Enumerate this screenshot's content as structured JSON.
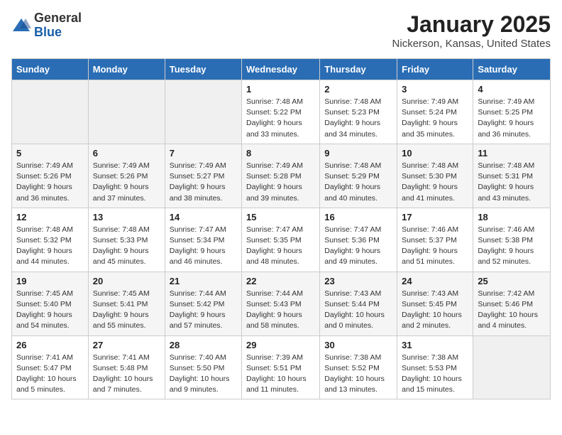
{
  "header": {
    "logo_general": "General",
    "logo_blue": "Blue",
    "title": "January 2025",
    "subtitle": "Nickerson, Kansas, United States"
  },
  "weekdays": [
    "Sunday",
    "Monday",
    "Tuesday",
    "Wednesday",
    "Thursday",
    "Friday",
    "Saturday"
  ],
  "weeks": [
    [
      {
        "day": "",
        "info": ""
      },
      {
        "day": "",
        "info": ""
      },
      {
        "day": "",
        "info": ""
      },
      {
        "day": "1",
        "info": "Sunrise: 7:48 AM\nSunset: 5:22 PM\nDaylight: 9 hours and 33 minutes."
      },
      {
        "day": "2",
        "info": "Sunrise: 7:48 AM\nSunset: 5:23 PM\nDaylight: 9 hours and 34 minutes."
      },
      {
        "day": "3",
        "info": "Sunrise: 7:49 AM\nSunset: 5:24 PM\nDaylight: 9 hours and 35 minutes."
      },
      {
        "day": "4",
        "info": "Sunrise: 7:49 AM\nSunset: 5:25 PM\nDaylight: 9 hours and 36 minutes."
      }
    ],
    [
      {
        "day": "5",
        "info": "Sunrise: 7:49 AM\nSunset: 5:26 PM\nDaylight: 9 hours and 36 minutes."
      },
      {
        "day": "6",
        "info": "Sunrise: 7:49 AM\nSunset: 5:26 PM\nDaylight: 9 hours and 37 minutes."
      },
      {
        "day": "7",
        "info": "Sunrise: 7:49 AM\nSunset: 5:27 PM\nDaylight: 9 hours and 38 minutes."
      },
      {
        "day": "8",
        "info": "Sunrise: 7:49 AM\nSunset: 5:28 PM\nDaylight: 9 hours and 39 minutes."
      },
      {
        "day": "9",
        "info": "Sunrise: 7:48 AM\nSunset: 5:29 PM\nDaylight: 9 hours and 40 minutes."
      },
      {
        "day": "10",
        "info": "Sunrise: 7:48 AM\nSunset: 5:30 PM\nDaylight: 9 hours and 41 minutes."
      },
      {
        "day": "11",
        "info": "Sunrise: 7:48 AM\nSunset: 5:31 PM\nDaylight: 9 hours and 43 minutes."
      }
    ],
    [
      {
        "day": "12",
        "info": "Sunrise: 7:48 AM\nSunset: 5:32 PM\nDaylight: 9 hours and 44 minutes."
      },
      {
        "day": "13",
        "info": "Sunrise: 7:48 AM\nSunset: 5:33 PM\nDaylight: 9 hours and 45 minutes."
      },
      {
        "day": "14",
        "info": "Sunrise: 7:47 AM\nSunset: 5:34 PM\nDaylight: 9 hours and 46 minutes."
      },
      {
        "day": "15",
        "info": "Sunrise: 7:47 AM\nSunset: 5:35 PM\nDaylight: 9 hours and 48 minutes."
      },
      {
        "day": "16",
        "info": "Sunrise: 7:47 AM\nSunset: 5:36 PM\nDaylight: 9 hours and 49 minutes."
      },
      {
        "day": "17",
        "info": "Sunrise: 7:46 AM\nSunset: 5:37 PM\nDaylight: 9 hours and 51 minutes."
      },
      {
        "day": "18",
        "info": "Sunrise: 7:46 AM\nSunset: 5:38 PM\nDaylight: 9 hours and 52 minutes."
      }
    ],
    [
      {
        "day": "19",
        "info": "Sunrise: 7:45 AM\nSunset: 5:40 PM\nDaylight: 9 hours and 54 minutes."
      },
      {
        "day": "20",
        "info": "Sunrise: 7:45 AM\nSunset: 5:41 PM\nDaylight: 9 hours and 55 minutes."
      },
      {
        "day": "21",
        "info": "Sunrise: 7:44 AM\nSunset: 5:42 PM\nDaylight: 9 hours and 57 minutes."
      },
      {
        "day": "22",
        "info": "Sunrise: 7:44 AM\nSunset: 5:43 PM\nDaylight: 9 hours and 58 minutes."
      },
      {
        "day": "23",
        "info": "Sunrise: 7:43 AM\nSunset: 5:44 PM\nDaylight: 10 hours and 0 minutes."
      },
      {
        "day": "24",
        "info": "Sunrise: 7:43 AM\nSunset: 5:45 PM\nDaylight: 10 hours and 2 minutes."
      },
      {
        "day": "25",
        "info": "Sunrise: 7:42 AM\nSunset: 5:46 PM\nDaylight: 10 hours and 4 minutes."
      }
    ],
    [
      {
        "day": "26",
        "info": "Sunrise: 7:41 AM\nSunset: 5:47 PM\nDaylight: 10 hours and 5 minutes."
      },
      {
        "day": "27",
        "info": "Sunrise: 7:41 AM\nSunset: 5:48 PM\nDaylight: 10 hours and 7 minutes."
      },
      {
        "day": "28",
        "info": "Sunrise: 7:40 AM\nSunset: 5:50 PM\nDaylight: 10 hours and 9 minutes."
      },
      {
        "day": "29",
        "info": "Sunrise: 7:39 AM\nSunset: 5:51 PM\nDaylight: 10 hours and 11 minutes."
      },
      {
        "day": "30",
        "info": "Sunrise: 7:38 AM\nSunset: 5:52 PM\nDaylight: 10 hours and 13 minutes."
      },
      {
        "day": "31",
        "info": "Sunrise: 7:38 AM\nSunset: 5:53 PM\nDaylight: 10 hours and 15 minutes."
      },
      {
        "day": "",
        "info": ""
      }
    ]
  ]
}
